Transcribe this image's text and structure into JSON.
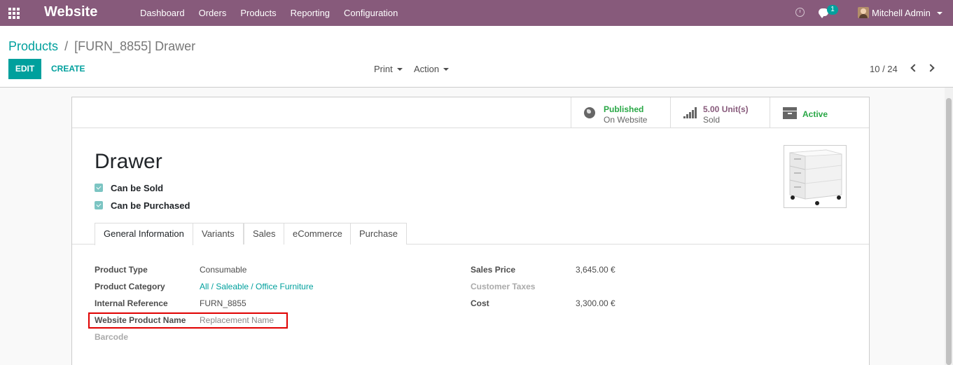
{
  "navbar": {
    "app_title": "Website",
    "menu": [
      "Dashboard",
      "Orders",
      "Products",
      "Reporting",
      "Configuration"
    ],
    "chat_count": "1",
    "user_name": "Mitchell Admin"
  },
  "control_panel": {
    "breadcrumb_parent": "Products",
    "breadcrumb_separator": "/",
    "breadcrumb_current": "[FURN_8855] Drawer",
    "edit_label": "EDIT",
    "create_label": "CREATE",
    "print_label": "Print",
    "action_label": "Action",
    "pager": "10 / 24"
  },
  "stat_buttons": {
    "published": {
      "value": "Published",
      "label": "On Website"
    },
    "sold": {
      "value": "5.00 Unit(s)",
      "label": "Sold"
    },
    "active": {
      "value": "Active"
    }
  },
  "product": {
    "name": "Drawer",
    "can_be_sold": "Can be Sold",
    "can_be_purchased": "Can be Purchased"
  },
  "tabs": [
    "General Information",
    "Variants",
    "Sales",
    "eCommerce",
    "Purchase"
  ],
  "fields_left": {
    "product_type": {
      "label": "Product Type",
      "value": "Consumable"
    },
    "product_category": {
      "label": "Product Category",
      "value": "All / Saleable / Office Furniture"
    },
    "internal_reference": {
      "label": "Internal Reference",
      "value": "FURN_8855"
    },
    "website_product_name": {
      "label": "Website Product Name",
      "value": "Replacement Name"
    },
    "barcode": {
      "label": "Barcode",
      "value": ""
    }
  },
  "fields_right": {
    "sales_price": {
      "label": "Sales Price",
      "value": "3,645.00 €"
    },
    "customer_taxes": {
      "label": "Customer Taxes",
      "value": ""
    },
    "cost": {
      "label": "Cost",
      "value": "3,300.00 €"
    }
  },
  "colors": {
    "brand": "#875a7b",
    "accent": "#00a09d",
    "success": "#28a745",
    "highlight": "#e00000"
  }
}
